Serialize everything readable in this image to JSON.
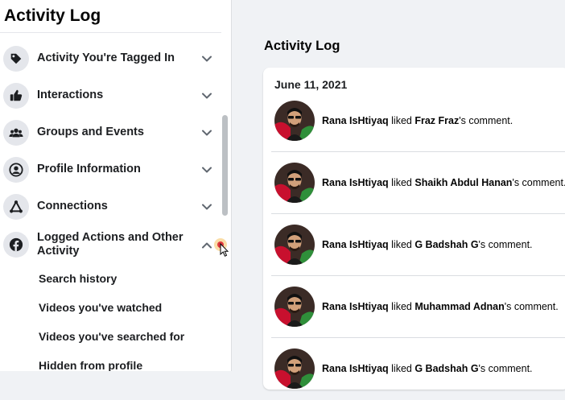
{
  "sidebar": {
    "title": "Activity Log",
    "items": [
      {
        "label": "Activity You're Tagged In",
        "icon": "tag-icon"
      },
      {
        "label": "Interactions",
        "icon": "thumbs-up-icon"
      },
      {
        "label": "Groups and Events",
        "icon": "people-icon"
      },
      {
        "label": "Profile Information",
        "icon": "user-circle-icon"
      },
      {
        "label": "Connections",
        "icon": "connections-icon"
      },
      {
        "label": "Logged Actions and Other Activity",
        "icon": "facebook-icon"
      }
    ],
    "sub_items": [
      "Search history",
      "Videos you've watched",
      "Videos you've searched for",
      "Hidden from profile"
    ]
  },
  "main": {
    "title": "Activity Log",
    "date": "June 11, 2021",
    "activities": [
      {
        "actor": "Rana IsHtiyaq",
        "verb": "liked",
        "target": "Fraz Fraz",
        "suffix": "'s comment."
      },
      {
        "actor": "Rana IsHtiyaq",
        "verb": "liked",
        "target": "Shaikh Abdul Hanan",
        "suffix": "'s comment."
      },
      {
        "actor": "Rana IsHtiyaq",
        "verb": "liked",
        "target": "G Badshah G",
        "suffix": "'s comment."
      },
      {
        "actor": "Rana IsHtiyaq",
        "verb": "liked",
        "target": "Muhammad Adnan",
        "suffix": "'s comment."
      },
      {
        "actor": "Rana IsHtiyaq",
        "verb": "liked",
        "target": "G Badshah G",
        "suffix": "'s comment."
      }
    ]
  },
  "colors": {
    "page_bg": "#f0f2f5",
    "card_bg": "#ffffff",
    "icon_bg": "#e4e6eb",
    "text": "#050505",
    "cursor_highlight": "#e0393e"
  }
}
